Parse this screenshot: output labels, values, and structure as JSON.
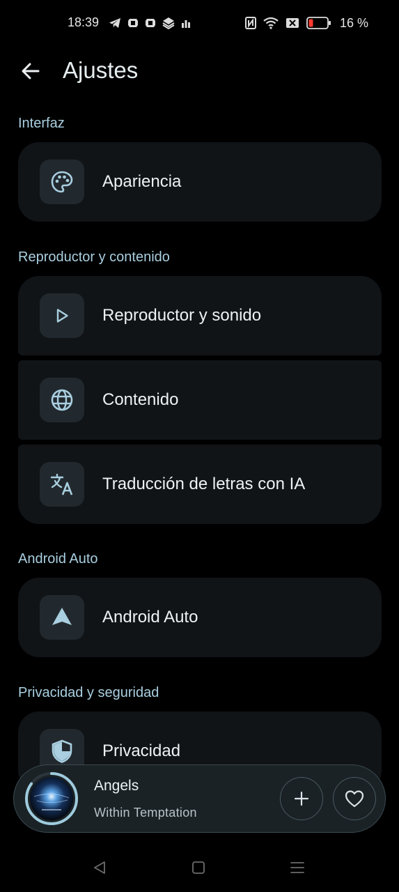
{
  "status_bar": {
    "time": "18:39",
    "battery_percent": "16 %",
    "left_icons": [
      "telegram-icon",
      "app-notification-icon",
      "app-notification-icon",
      "app-notification-icon",
      "signal-bars-icon"
    ],
    "right_icons": [
      "nfc-icon",
      "wifi-icon",
      "sim-off-icon",
      "battery-icon"
    ]
  },
  "header": {
    "title": "Ajustes",
    "back_icon": "arrow-back-icon"
  },
  "sections": [
    {
      "title": "Interfaz",
      "items": [
        {
          "label": "Apariencia",
          "icon": "palette-icon"
        }
      ]
    },
    {
      "title": "Reproductor y contenido",
      "items": [
        {
          "label": "Reproductor y sonido",
          "icon": "play-icon"
        },
        {
          "label": "Contenido",
          "icon": "globe-icon"
        },
        {
          "label": "Traducción de letras con IA",
          "icon": "translate-icon"
        }
      ]
    },
    {
      "title": "Android Auto",
      "items": [
        {
          "label": "Android Auto",
          "icon": "navigation-arrow-icon"
        }
      ]
    },
    {
      "title": "Privacidad y seguridad",
      "items": [
        {
          "label": "Privacidad",
          "icon": "shield-icon"
        }
      ]
    }
  ],
  "mini_player": {
    "title": "Angels",
    "artist": "Within Temptation",
    "add_icon": "plus-icon",
    "favorite_icon": "heart-icon",
    "progress": 0.85
  },
  "nav_bar": {
    "icons": [
      "back-triangle-icon",
      "home-square-icon",
      "recents-menu-icon"
    ]
  },
  "colors": {
    "background": "#000000",
    "card": "#101417",
    "icon_box": "#22292e",
    "section_title": "#a9cfe0",
    "player_bg": "#1a2226",
    "progress_ring": "#9ecbdc"
  }
}
